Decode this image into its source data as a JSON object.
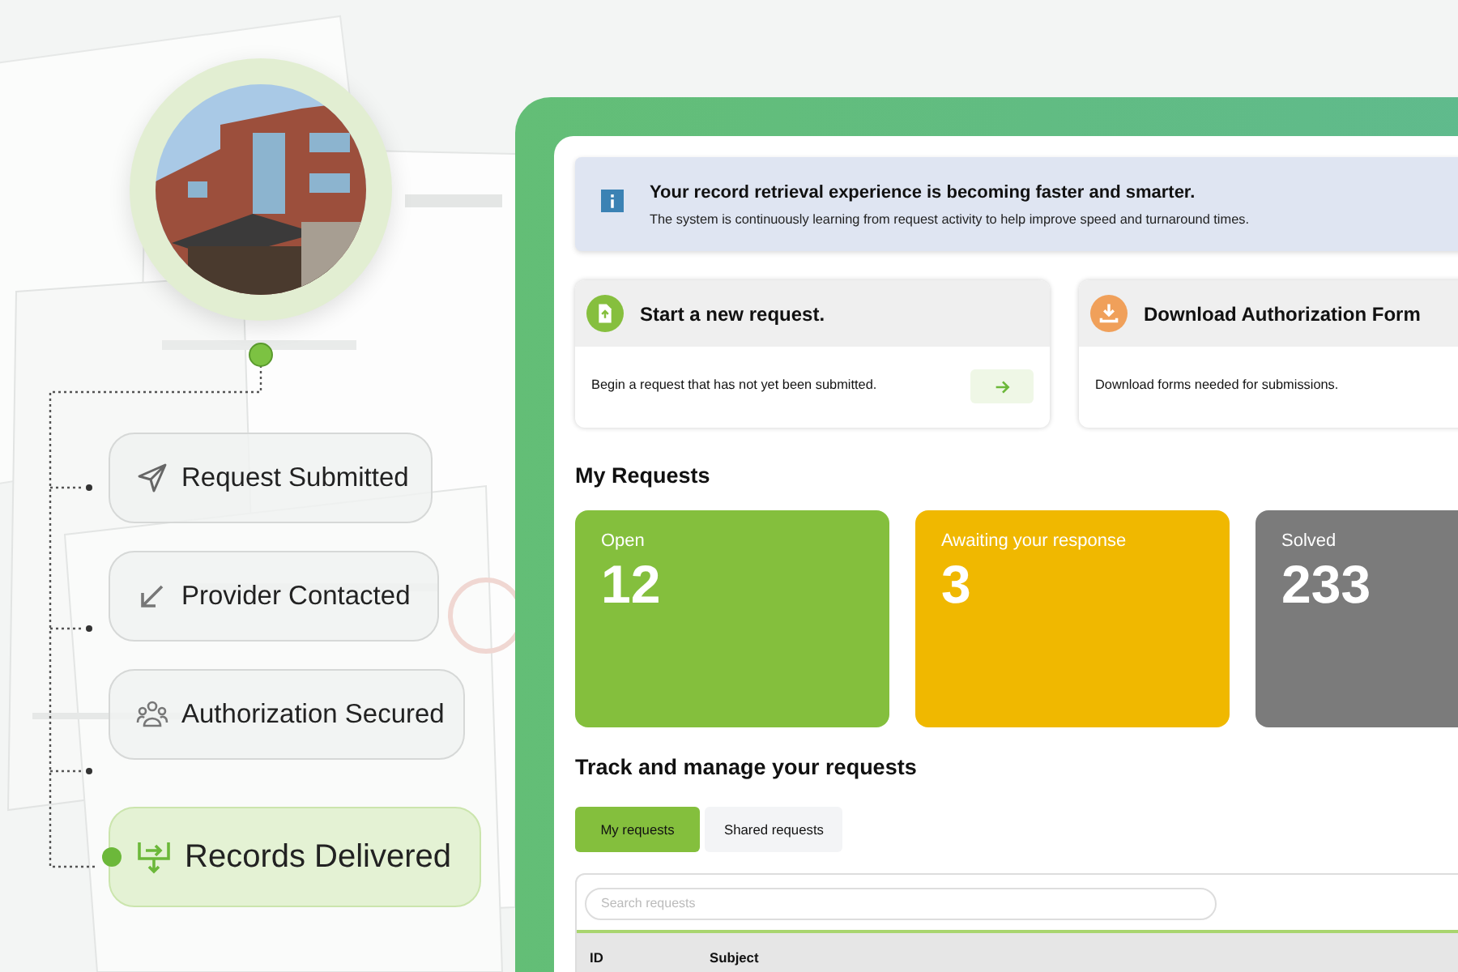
{
  "steps": [
    {
      "label": "Request Submitted",
      "kind": "send",
      "current": false
    },
    {
      "label": "Provider Contacted",
      "kind": "arrow",
      "current": false
    },
    {
      "label": "Authorization Secured",
      "kind": "people",
      "current": false
    },
    {
      "label": "Records Delivered",
      "kind": "deliver",
      "current": true
    }
  ],
  "banner": {
    "title": "Your record retrieval experience is becoming faster and smarter.",
    "text": "The system is continuously learning from request activity to help improve speed and turnaround times."
  },
  "actions": [
    {
      "title": "Start a new request.",
      "text": "Begin a request that has not yet been submitted.",
      "kind": "new",
      "color": "#86bf3e",
      "has_button": true
    },
    {
      "title": "Download Authorization Form",
      "text": "Download forms needed for submissions.",
      "kind": "download",
      "color": "#f0a05a",
      "has_button": false
    }
  ],
  "my_requests": {
    "title": "My Requests",
    "stats": [
      {
        "label": "Open",
        "count": "12",
        "color": "#84bf3d"
      },
      {
        "label": "Awaiting your response",
        "count": "3",
        "color": "#f0b800"
      },
      {
        "label": "Solved",
        "count": "233",
        "color": "#7b7b7b"
      }
    ]
  },
  "track": {
    "title": "Track and manage your requests",
    "tabs": [
      {
        "label": "My requests",
        "selected": true
      },
      {
        "label": "Shared requests",
        "selected": false
      }
    ],
    "search": {
      "placeholder": "Search requests"
    },
    "columns": [
      "ID",
      "Subject"
    ]
  }
}
